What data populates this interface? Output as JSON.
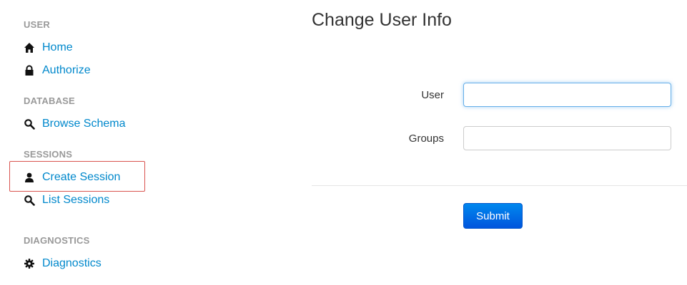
{
  "sidebar": {
    "sections": [
      {
        "heading": "USER",
        "items": [
          {
            "label": "Home",
            "icon": "home-icon"
          },
          {
            "label": "Authorize",
            "icon": "lock-icon"
          }
        ]
      },
      {
        "heading": "DATABASE",
        "items": [
          {
            "label": "Browse Schema",
            "icon": "search-icon"
          }
        ]
      },
      {
        "heading": "SESSIONS",
        "items": [
          {
            "label": "Create Session",
            "icon": "user-icon",
            "highlighted": true
          },
          {
            "label": "List Sessions",
            "icon": "search-icon"
          }
        ]
      },
      {
        "heading": "DIAGNOSTICS",
        "items": [
          {
            "label": "Diagnostics",
            "icon": "gear-icon"
          }
        ]
      }
    ]
  },
  "main": {
    "title": "Change User Info",
    "form": {
      "user_label": "User",
      "user_value": "",
      "groups_label": "Groups",
      "groups_value": "",
      "submit_label": "Submit"
    }
  },
  "colors": {
    "link": "#0088cc",
    "section_heading": "#999999",
    "highlight_border": "#d9534f",
    "button": "#0066dd",
    "focus_border": "#66afe9"
  }
}
